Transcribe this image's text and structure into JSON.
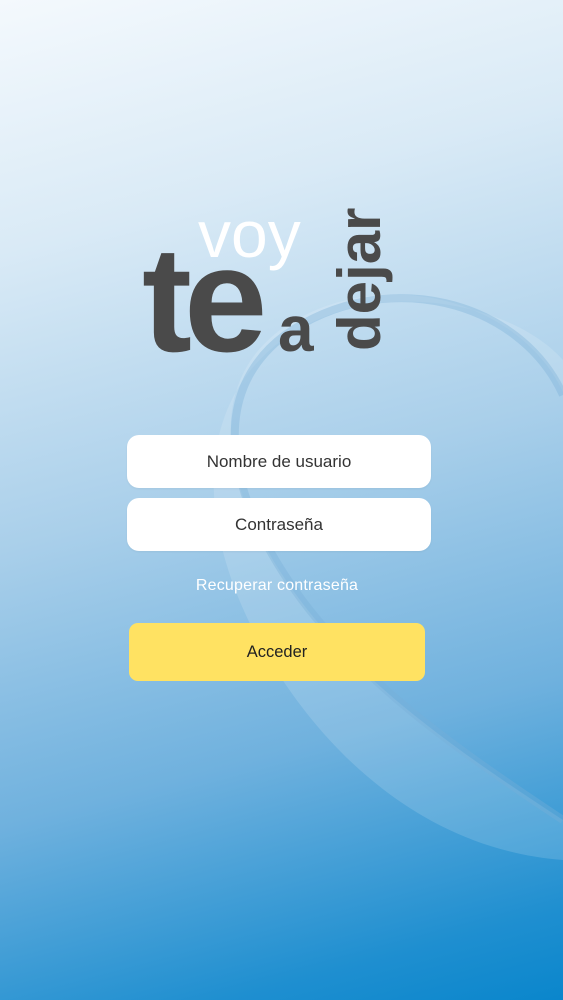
{
  "logo": {
    "word_te": "te",
    "word_voy": "voy",
    "word_a": "a",
    "word_dejar": "dejar"
  },
  "login": {
    "username_label": "Nombre de usuario",
    "password_label": "Contraseña",
    "recover_label": "Recuperar contraseña",
    "submit_label": "Acceder"
  },
  "colors": {
    "logo_dark": "#4a4a4a",
    "logo_light": "#ffffff",
    "button_yellow": "#ffe262",
    "link_text": "#ffffff",
    "gradient_top": "#f4f9fd",
    "gradient_bottom": "#0a86cc"
  },
  "icons": {
    "background": "heart-outline-icon"
  }
}
